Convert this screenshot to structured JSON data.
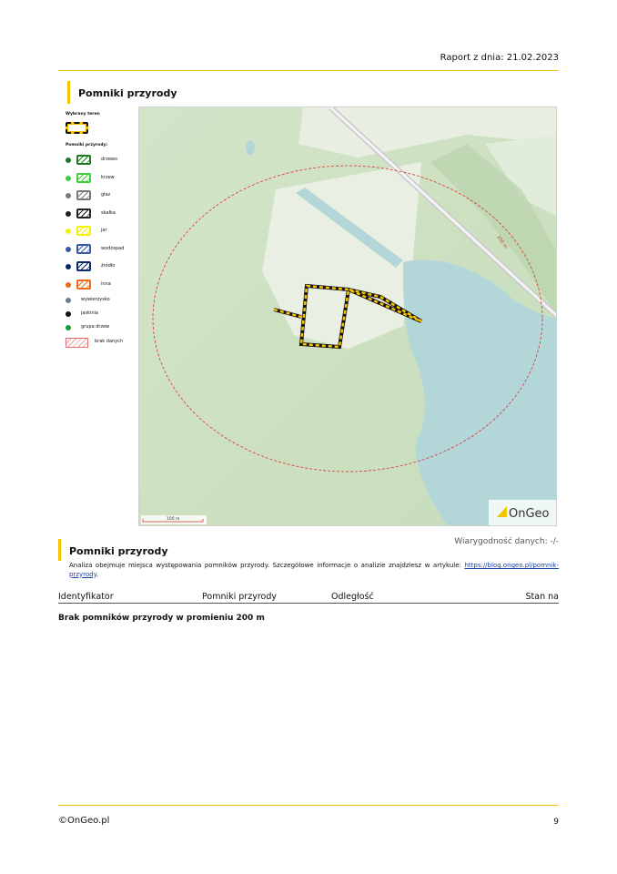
{
  "header": {
    "report_date": "Raport z dnia: 21.02.2023"
  },
  "section1": {
    "title": "Pomniki przyrody"
  },
  "legend": {
    "selected_area_label": "Wybrany teren",
    "monuments_label": "Pomniki przyrody:",
    "items": [
      {
        "label": "drzewo",
        "color": "#1e7a1e"
      },
      {
        "label": "krzew",
        "color": "#3ccf3c"
      },
      {
        "label": "głaz",
        "color": "#7a7a7a"
      },
      {
        "label": "skałka",
        "color": "#222222"
      },
      {
        "label": "jar",
        "color": "#f3f300"
      },
      {
        "label": "wodospad",
        "color": "#3a5aa8"
      },
      {
        "label": "źródło",
        "color": "#0a2a6a"
      },
      {
        "label": "inna",
        "color": "#f06a1a"
      }
    ],
    "point_items": [
      {
        "label": "wywierzysko",
        "color": "#6a7a9a"
      },
      {
        "label": "jaskinia",
        "color": "#111111"
      },
      {
        "label": "grupa drzew",
        "color": "#1a9a2a"
      }
    ],
    "no_data_label": "brak danych"
  },
  "map": {
    "radius_label": "200 m",
    "scale_label": "100 m",
    "brand": "OnGeo"
  },
  "section2": {
    "title": "Pomniki przyrody",
    "reliability": "Wiarygodność danych: -/-",
    "description": "Analiza obejmuje miejsca występowania pomników przyrody. Szczegółowe informacje o analizie znajdziesz w artykule:",
    "link_text": "https://blog.ongeo.pl/pomnik-przyrody",
    "table_headers": [
      "Identyfikator",
      "Pomniki przyrody",
      "Odległość",
      "Stan na"
    ],
    "empty_message": "Brak pomników przyrody w promieniu 200 m"
  },
  "footer": {
    "copyright": "©OnGeo.pl",
    "page_number": "9"
  },
  "colors": {
    "accent": "#f5c400",
    "water": "#b3d6d8",
    "terrain": "#d9e8cf"
  }
}
